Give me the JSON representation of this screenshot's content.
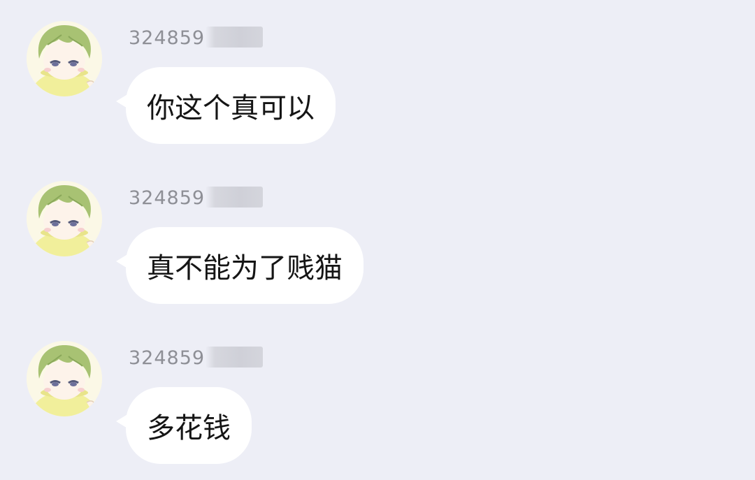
{
  "messages": [
    {
      "sender": "324859",
      "text": "你这个真可以"
    },
    {
      "sender": "324859",
      "text": "真不能为了贱猫"
    },
    {
      "sender": "324859",
      "text": "多花钱"
    }
  ],
  "colors": {
    "background": "#edeef6",
    "bubble": "#ffffff",
    "sender_text": "#8e8f96",
    "message_text": "#151515"
  },
  "icons": {
    "avatar": "anime-avatar-icon"
  }
}
